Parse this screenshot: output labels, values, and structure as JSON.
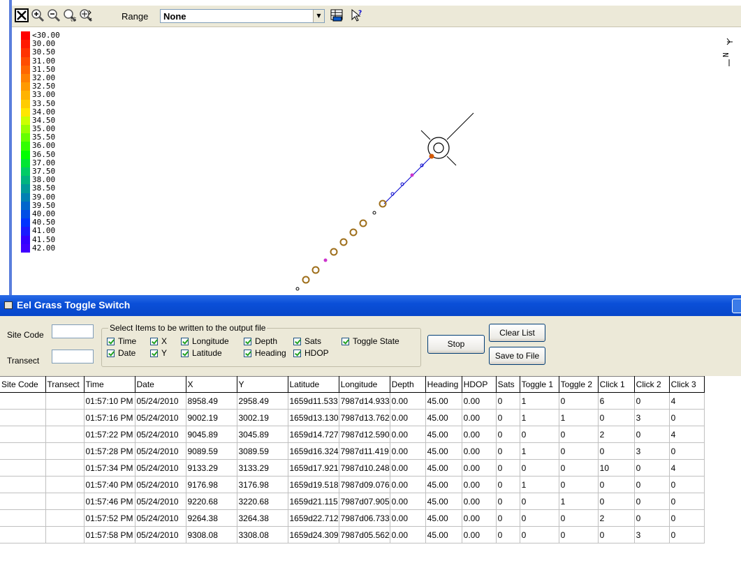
{
  "toolbar": {
    "buttons": [
      "zoom-full-icon",
      "zoom-in-icon",
      "zoom-out-icon",
      "zoom-window-icon",
      "zoom-pan-icon"
    ],
    "range_label": "Range",
    "range_value": "None",
    "extra_buttons": [
      "grid-export-icon",
      "pointer-info-icon"
    ]
  },
  "map": {
    "north_arrow_label": "N",
    "legend": [
      {
        "label": "<30.00",
        "color": "#ff0000"
      },
      {
        "label": "30.00",
        "color": "#ff1a00"
      },
      {
        "label": "30.50",
        "color": "#ff3300"
      },
      {
        "label": "31.00",
        "color": "#ff4d00"
      },
      {
        "label": "31.50",
        "color": "#ff6600"
      },
      {
        "label": "32.00",
        "color": "#ff8000"
      },
      {
        "label": "32.50",
        "color": "#ff9900"
      },
      {
        "label": "33.00",
        "color": "#ffb300"
      },
      {
        "label": "33.50",
        "color": "#ffcc00"
      },
      {
        "label": "34.00",
        "color": "#ffe600"
      },
      {
        "label": "34.50",
        "color": "#ccff00"
      },
      {
        "label": "35.00",
        "color": "#99ff00"
      },
      {
        "label": "35.50",
        "color": "#66ff00"
      },
      {
        "label": "36.00",
        "color": "#33ff00"
      },
      {
        "label": "36.50",
        "color": "#00ff00"
      },
      {
        "label": "37.00",
        "color": "#00e633"
      },
      {
        "label": "37.50",
        "color": "#00cc66"
      },
      {
        "label": "38.00",
        "color": "#00b380"
      },
      {
        "label": "38.50",
        "color": "#009999"
      },
      {
        "label": "39.00",
        "color": "#0080b3"
      },
      {
        "label": "39.50",
        "color": "#0066cc"
      },
      {
        "label": "40.00",
        "color": "#004de6"
      },
      {
        "label": "40.50",
        "color": "#0033ff"
      },
      {
        "label": "41.00",
        "color": "#1a1aff"
      },
      {
        "label": "41.50",
        "color": "#3300ff"
      },
      {
        "label": "42.00",
        "color": "#4000ff"
      }
    ]
  },
  "dialog": {
    "title": "Eel Grass Toggle Switch",
    "site_code_label": "Site Code",
    "transect_label": "Transect",
    "site_code_value": "",
    "transect_value": "",
    "group_title": "Select Items to be written to the output file",
    "checkboxes": [
      {
        "label": "Time",
        "checked": true
      },
      {
        "label": "X",
        "checked": true
      },
      {
        "label": "Longitude",
        "checked": true
      },
      {
        "label": "Depth",
        "checked": true
      },
      {
        "label": "Sats",
        "checked": true
      },
      {
        "label": "Toggle State",
        "checked": true
      },
      {
        "label": "Date",
        "checked": true
      },
      {
        "label": "Y",
        "checked": true
      },
      {
        "label": "Latitude",
        "checked": true
      },
      {
        "label": "Heading",
        "checked": true
      },
      {
        "label": "HDOP",
        "checked": true
      }
    ],
    "stop_label": "Stop",
    "clear_list_label": "Clear List",
    "save_label": "Save to File"
  },
  "table": {
    "columns": [
      "Site Code",
      "Transect",
      "Time",
      "Date",
      "X",
      "Y",
      "Latitude",
      "Longitude",
      "Depth",
      "Heading",
      "HDOP",
      "Sats",
      "Toggle 1",
      "Toggle 2",
      "Click 1",
      "Click 2",
      "Click 3"
    ],
    "rows": [
      [
        "",
        "",
        "01:57:10 PM",
        "05/24/2010",
        "8958.49",
        "2958.49",
        "1659d11.533",
        "7987d14.933",
        "0.00",
        "45.00",
        "0.00",
        "0",
        "1",
        "0",
        "6",
        "0",
        "4"
      ],
      [
        "",
        "",
        "01:57:16 PM",
        "05/24/2010",
        "9002.19",
        "3002.19",
        "1659d13.130",
        "7987d13.762",
        "0.00",
        "45.00",
        "0.00",
        "0",
        "1",
        "1",
        "0",
        "3",
        "0"
      ],
      [
        "",
        "",
        "01:57:22 PM",
        "05/24/2010",
        "9045.89",
        "3045.89",
        "1659d14.727",
        "7987d12.590",
        "0.00",
        "45.00",
        "0.00",
        "0",
        "0",
        "0",
        "2",
        "0",
        "4"
      ],
      [
        "",
        "",
        "01:57:28 PM",
        "05/24/2010",
        "9089.59",
        "3089.59",
        "1659d16.324",
        "7987d11.419",
        "0.00",
        "45.00",
        "0.00",
        "0",
        "1",
        "0",
        "0",
        "3",
        "0"
      ],
      [
        "",
        "",
        "01:57:34 PM",
        "05/24/2010",
        "9133.29",
        "3133.29",
        "1659d17.921",
        "7987d10.248",
        "0.00",
        "45.00",
        "0.00",
        "0",
        "0",
        "0",
        "10",
        "0",
        "4"
      ],
      [
        "",
        "",
        "01:57:40 PM",
        "05/24/2010",
        "9176.98",
        "3176.98",
        "1659d19.518",
        "7987d09.076",
        "0.00",
        "45.00",
        "0.00",
        "0",
        "1",
        "0",
        "0",
        "0",
        "0"
      ],
      [
        "",
        "",
        "01:57:46 PM",
        "05/24/2010",
        "9220.68",
        "3220.68",
        "1659d21.115",
        "7987d07.905",
        "0.00",
        "45.00",
        "0.00",
        "0",
        "0",
        "1",
        "0",
        "0",
        "0"
      ],
      [
        "",
        "",
        "01:57:52 PM",
        "05/24/2010",
        "9264.38",
        "3264.38",
        "1659d22.712",
        "7987d06.733",
        "0.00",
        "45.00",
        "0.00",
        "0",
        "0",
        "0",
        "2",
        "0",
        "0"
      ],
      [
        "",
        "",
        "01:57:58 PM",
        "05/24/2010",
        "9308.08",
        "3308.08",
        "1659d24.309",
        "7987d05.562",
        "0.00",
        "45.00",
        "0.00",
        "0",
        "0",
        "0",
        "0",
        "3",
        "0"
      ]
    ]
  }
}
